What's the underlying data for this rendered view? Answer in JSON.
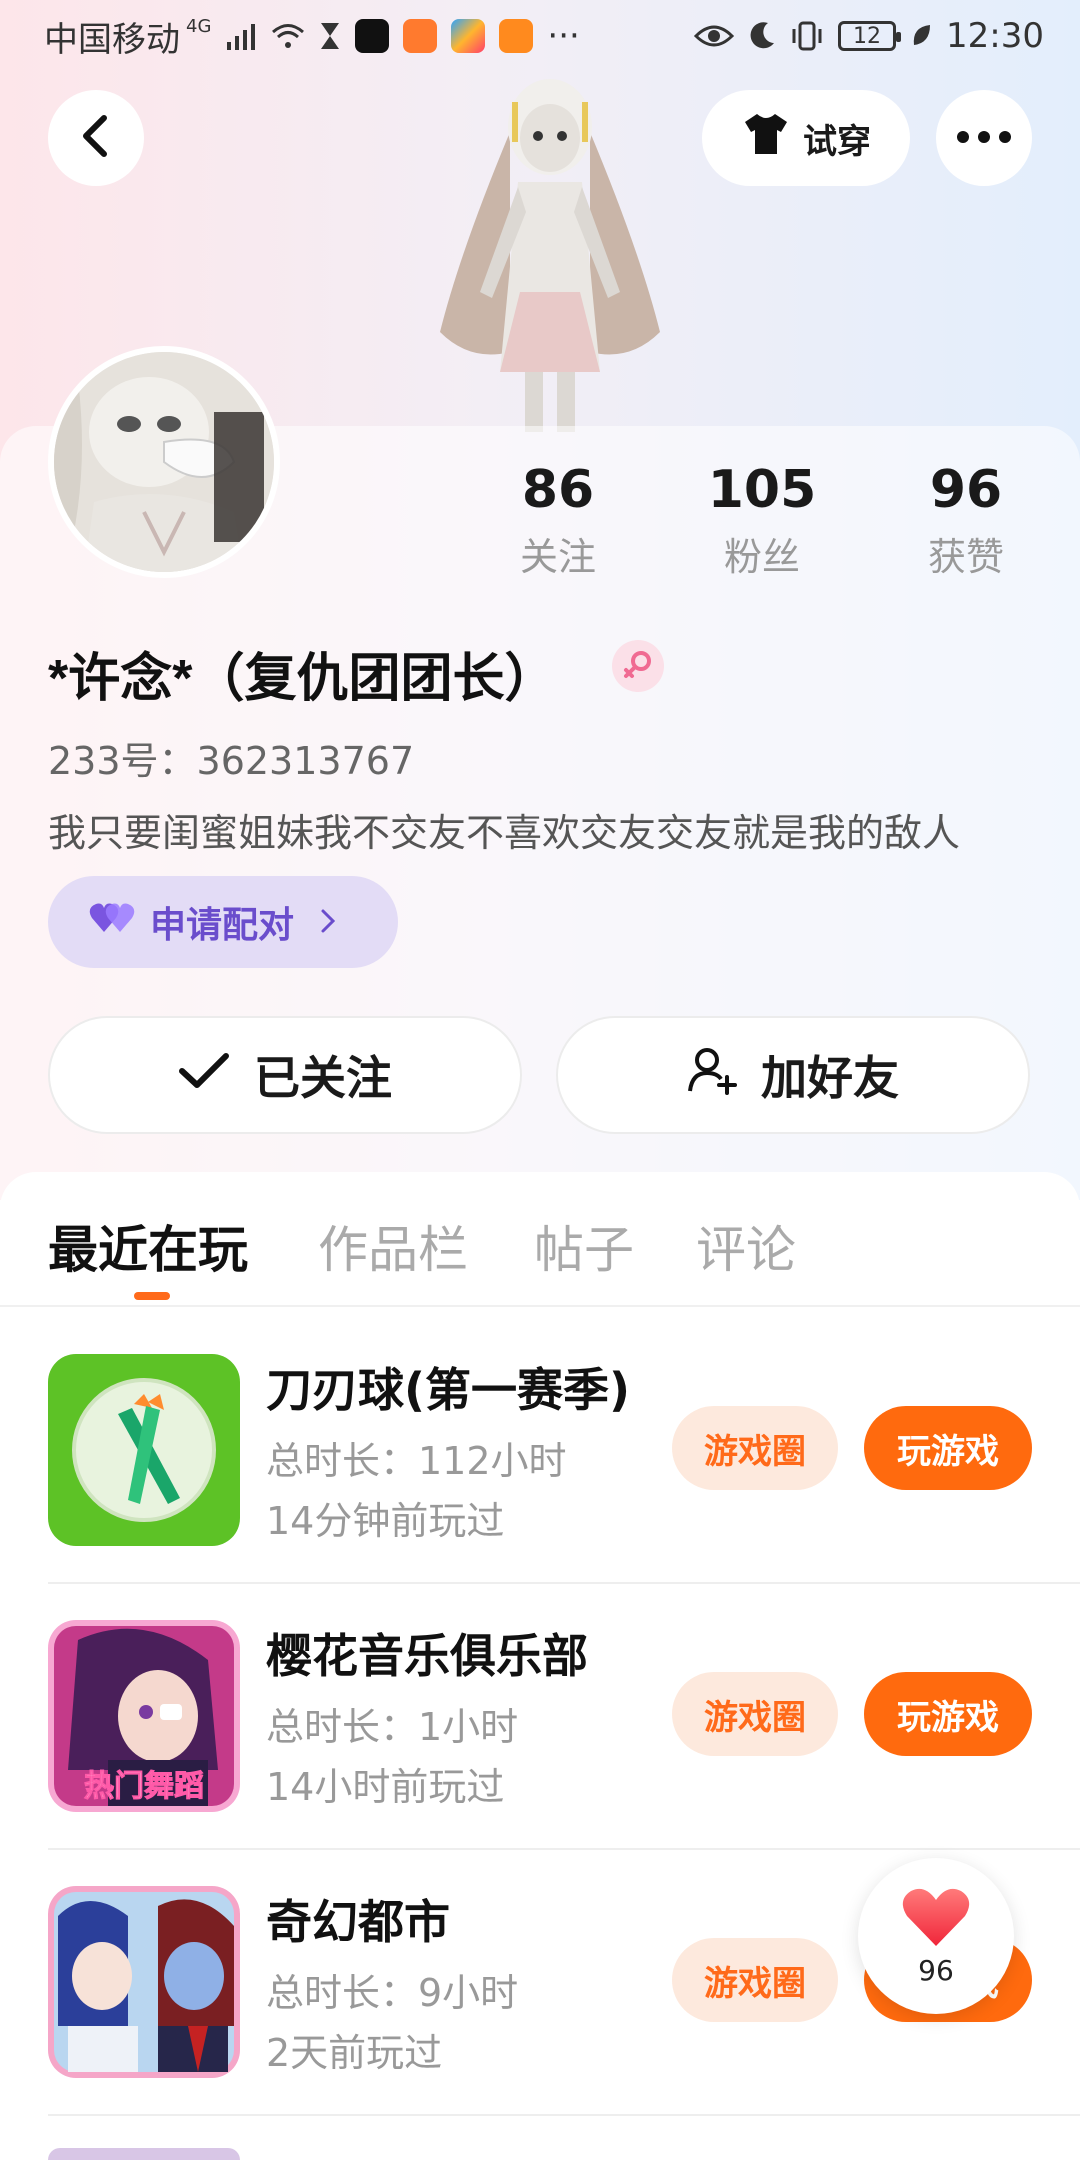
{
  "status_bar": {
    "carrier": "中国移动",
    "network": "4G",
    "time": "12:30",
    "battery": "12",
    "more_dots": "···"
  },
  "header": {
    "try_on_label": "试穿"
  },
  "profile": {
    "stats": [
      {
        "value": "86",
        "label": "关注"
      },
      {
        "value": "105",
        "label": "粉丝"
      },
      {
        "value": "96",
        "label": "获赞"
      }
    ],
    "username": "*许念*（复仇团团长）",
    "uid": "233号：362313767",
    "bio": "我只要闺蜜姐妹我不交友不喜欢交友交友就是我的敌人",
    "pair_label": "申请配对",
    "follow_label": "已关注",
    "add_friend_label": "加好友"
  },
  "tabs": [
    {
      "label": "最近在玩"
    },
    {
      "label": "作品栏"
    },
    {
      "label": "帖子"
    },
    {
      "label": "评论"
    }
  ],
  "games": [
    {
      "title": "刀刃球(第一赛季)",
      "duration": "总时长：112小时",
      "last_played": "14分钟前玩过",
      "circle_label": "游戏圈",
      "play_label": "玩游戏"
    },
    {
      "title": "樱花音乐俱乐部",
      "duration": "总时长：1小时",
      "last_played": "14小时前玩过",
      "circle_label": "游戏圈",
      "play_label": "玩游戏",
      "icon_text": "热门舞蹈"
    },
    {
      "title": "奇幻都市",
      "duration": "总时长：9小时",
      "last_played": "2天前玩过",
      "circle_label": "游戏圈",
      "play_label": "玩游戏"
    }
  ],
  "like_float": {
    "count": "96"
  },
  "colors": {
    "accent": "#ff6a0e",
    "pair_bg": "#e3dcf6",
    "pair_text": "#6a4dcc"
  }
}
